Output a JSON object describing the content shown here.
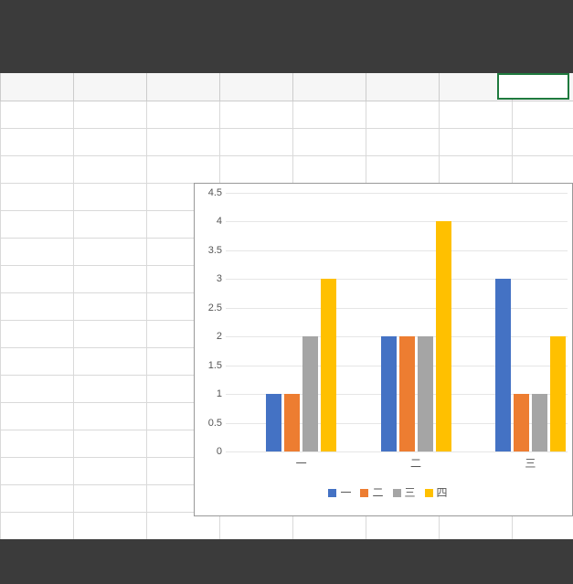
{
  "chart_data": {
    "type": "bar",
    "categories": [
      "一",
      "二",
      "三"
    ],
    "series": [
      {
        "name": "一",
        "values": [
          1,
          2,
          3
        ],
        "color": "#4472c4"
      },
      {
        "name": "二",
        "values": [
          1,
          2,
          1
        ],
        "color": "#ed7d31"
      },
      {
        "name": "三",
        "values": [
          2,
          2,
          1
        ],
        "color": "#a5a5a5"
      },
      {
        "name": "四",
        "values": [
          3,
          4,
          2
        ],
        "color": "#ffc000"
      }
    ],
    "ylabel": "",
    "xlabel": "",
    "title": "",
    "ylim": [
      0,
      4.5
    ],
    "yticks": [
      0,
      0.5,
      1,
      1.5,
      2,
      2.5,
      3,
      3.5,
      4,
      4.5
    ]
  }
}
